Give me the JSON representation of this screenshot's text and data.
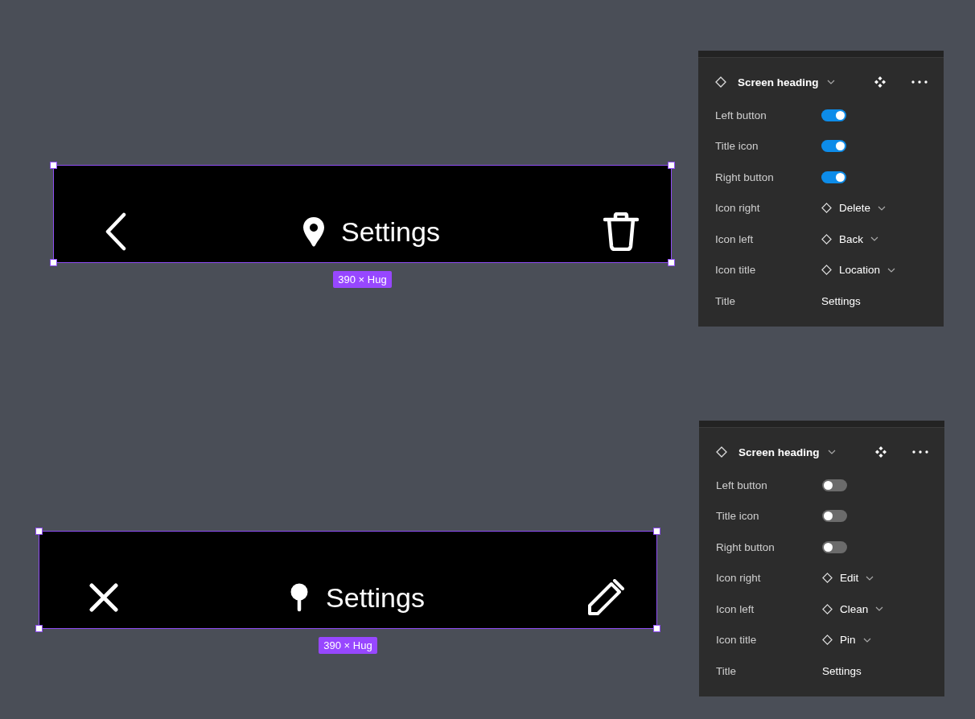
{
  "sections": [
    {
      "heading": {
        "left_button": {
          "kind": "back"
        },
        "title_icon": {
          "kind": "location"
        },
        "right_button": {
          "kind": "delete"
        },
        "title": "Settings",
        "selected": true,
        "size_label": "390 × Hug"
      },
      "panel": {
        "component": "Screen heading",
        "properties": [
          {
            "kind": "toggle",
            "label": "Left button",
            "on": true
          },
          {
            "kind": "toggle",
            "label": "Title icon",
            "on": true
          },
          {
            "kind": "toggle",
            "label": "Right button",
            "on": true
          },
          {
            "kind": "instance",
            "label": "Icon right",
            "value": "Delete"
          },
          {
            "kind": "instance",
            "label": "Icon left",
            "value": "Back"
          },
          {
            "kind": "instance",
            "label": "Icon title",
            "value": "Location"
          },
          {
            "kind": "text",
            "label": "Title",
            "value": "Settings"
          }
        ]
      }
    },
    {
      "heading": {
        "left_button": {
          "kind": "close"
        },
        "title_icon": {
          "kind": "pin"
        },
        "right_button": {
          "kind": "edit"
        },
        "title": "Settings",
        "selected": true,
        "size_label": "390 × Hug"
      },
      "panel": {
        "component": "Screen heading",
        "properties": [
          {
            "kind": "toggle",
            "label": "Left button",
            "on": false
          },
          {
            "kind": "toggle",
            "label": "Title icon",
            "on": false
          },
          {
            "kind": "toggle",
            "label": "Right button",
            "on": false
          },
          {
            "kind": "instance",
            "label": "Icon right",
            "value": "Edit"
          },
          {
            "kind": "instance",
            "label": "Icon left",
            "value": "Clean"
          },
          {
            "kind": "instance",
            "label": "Icon title",
            "value": "Pin"
          },
          {
            "kind": "text",
            "label": "Title",
            "value": "Settings"
          }
        ]
      }
    }
  ]
}
